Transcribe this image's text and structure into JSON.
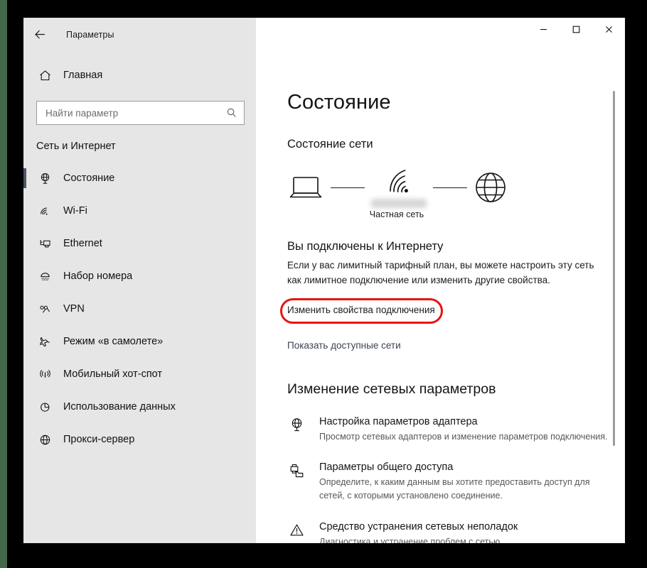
{
  "window": {
    "app_title": "Параметры",
    "back_icon": "back-arrow-icon",
    "minimize_label": "—",
    "maximize_label": "□",
    "close_label": "✕"
  },
  "sidebar": {
    "home_label": "Главная",
    "home_icon": "home-icon",
    "search": {
      "placeholder": "Найти параметр",
      "value": "",
      "icon": "search-icon"
    },
    "category_title": "Сеть и Интернет",
    "items": [
      {
        "label": "Состояние",
        "icon": "network-status-icon",
        "active": true
      },
      {
        "label": "Wi-Fi",
        "icon": "wifi-icon",
        "active": false
      },
      {
        "label": "Ethernet",
        "icon": "ethernet-icon",
        "active": false
      },
      {
        "label": "Набор номера",
        "icon": "dial-up-icon",
        "active": false
      },
      {
        "label": "VPN",
        "icon": "vpn-icon",
        "active": false
      },
      {
        "label": "Режим «в самолете»",
        "icon": "airplane-icon",
        "active": false
      },
      {
        "label": "Мобильный хот-спот",
        "icon": "hotspot-icon",
        "active": false
      },
      {
        "label": "Использование данных",
        "icon": "data-usage-icon",
        "active": false
      },
      {
        "label": "Прокси-сервер",
        "icon": "proxy-globe-icon",
        "active": false
      }
    ]
  },
  "main": {
    "page_title": "Состояние",
    "network_status_heading": "Состояние сети",
    "diagram": {
      "device_icon": "laptop-icon",
      "signal_icon": "wifi-signal-icon",
      "internet_icon": "globe-icon",
      "network_name_redacted": "",
      "network_type": "Частная сеть"
    },
    "connection_title": "Вы подключены к Интернету",
    "connection_description": "Если у вас лимитный тарифный план, вы можете настроить эту сеть как лимитное подключение или изменить другие свойства.",
    "highlighted_link": "Изменить свойства подключения",
    "secondary_link": "Показать доступные сети",
    "change_settings_heading": "Изменение сетевых параметров",
    "options": [
      {
        "title": "Настройка параметров адаптера",
        "description": "Просмотр сетевых адаптеров и изменение параметров подключения.",
        "icon": "adapter-globe-icon"
      },
      {
        "title": "Параметры общего доступа",
        "description": "Определите, к каким данным вы хотите предоставить доступ для сетей, с которыми установлено соединение.",
        "icon": "sharing-icon"
      },
      {
        "title": "Средство устранения сетевых неполадок",
        "description": "Диагностика и устранение проблем с сетью.",
        "icon": "troubleshoot-warning-icon"
      }
    ]
  },
  "annotation": {
    "highlight_color": "#e81313",
    "shape": "rounded-rectangle"
  },
  "colors": {
    "sidebar_background": "#e6e6e6",
    "main_background": "#ffffff",
    "selection_indicator": "#4a5568",
    "edge_strip": "#44684a",
    "link_color": "#3b4252"
  }
}
